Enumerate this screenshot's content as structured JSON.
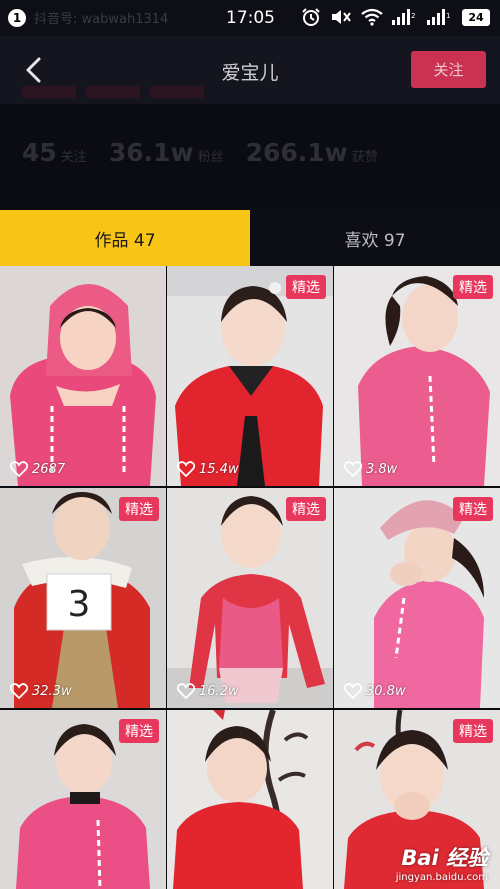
{
  "status_bar": {
    "notification_count": "1",
    "ghost_text": "抖音号: wabwah1314",
    "time": "17:05",
    "battery": "24"
  },
  "header": {
    "title": "爱宝儿",
    "follow_label": "关注"
  },
  "profile": {
    "stats": [
      {
        "value": "45",
        "label": "关注"
      },
      {
        "value": "36.1w",
        "label": "粉丝"
      },
      {
        "value": "266.1w",
        "label": "获赞"
      }
    ]
  },
  "tabs": [
    {
      "label": "作品 47",
      "active": true
    },
    {
      "label": "喜欢 97",
      "active": false
    }
  ],
  "videos": [
    {
      "likes": "2687",
      "featured": false,
      "badge": ""
    },
    {
      "likes": "15.4w",
      "featured": true,
      "badge": "精选"
    },
    {
      "likes": "3.8w",
      "featured": true,
      "badge": "精选"
    },
    {
      "likes": "32.3w",
      "featured": true,
      "badge": "精选",
      "sign": "3"
    },
    {
      "likes": "16.2w",
      "featured": true,
      "badge": "精选"
    },
    {
      "likes": "30.8w",
      "featured": true,
      "badge": "精选"
    },
    {
      "likes": "",
      "featured": true,
      "badge": "精选"
    },
    {
      "likes": "",
      "featured": false,
      "badge": ""
    },
    {
      "likes": "",
      "featured": true,
      "badge": "精选"
    }
  ],
  "watermark": {
    "brand": "Bai 经验",
    "url": "jingyan.baidu.com"
  },
  "colors": {
    "accent_yellow": "#f8c416",
    "follow_red": "#c93251",
    "badge_pink": "#e8375d"
  }
}
